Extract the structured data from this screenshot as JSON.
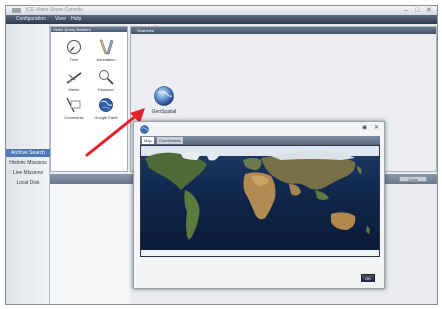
{
  "window": {
    "title": "ICE Video Share Console",
    "controls": [
      "–",
      "□",
      "✕"
    ]
  },
  "menu": [
    "Configuration",
    "View",
    "Help"
  ],
  "sidebar": {
    "items": [
      {
        "label": "Archive Search",
        "selected": true
      },
      {
        "label": "Historic Missions",
        "selected": false
      },
      {
        "label": "Live Missions",
        "selected": false
      },
      {
        "label": "Local Disk",
        "selected": false
      }
    ]
  },
  "toolbox": {
    "title": "Video Query Builders",
    "tools": [
      {
        "label": "Time",
        "icon": "stopwatch-icon"
      },
      {
        "label": "Annotation",
        "icon": "pencil-icon"
      },
      {
        "label": "Metric",
        "icon": "gauge-icon"
      },
      {
        "label": "Keyword",
        "icon": "magnifier-icon"
      },
      {
        "label": "Comments",
        "icon": "note-icon"
      },
      {
        "label": "Google Earth",
        "icon": "earth-icon"
      }
    ]
  },
  "search": {
    "title": "Searches",
    "item_label": "GeoSpatial"
  },
  "results": {
    "button_label": "Close"
  },
  "dialog": {
    "tabs": [
      {
        "label": "Map",
        "active": true
      },
      {
        "label": "Coordinates",
        "active": false
      }
    ],
    "ok_label": "OK"
  },
  "annotation": {
    "color": "#e8202a"
  }
}
